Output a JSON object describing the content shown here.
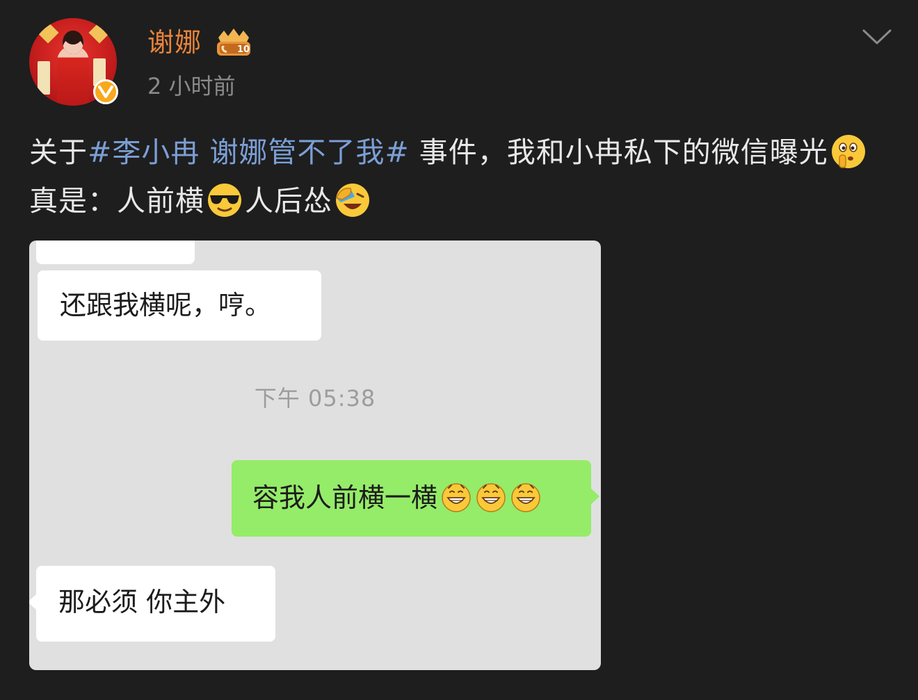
{
  "author": {
    "name": "谢娜",
    "time": "2 小时前",
    "level_badge_text": "10"
  },
  "post": {
    "prefix": "关于",
    "hashtag": "#李小冉 谢娜管不了我#",
    "text_1": " 事件，我和小冉私下的微信曝光",
    "text_2": "  真是：人前横",
    "text_3": "人后怂"
  },
  "chat": {
    "msg_in_1": "还跟我横呢，哼。",
    "time_label": "下午 05:38",
    "msg_out": "容我人前横一横",
    "msg_in_2": "那必须 你主外"
  },
  "colors": {
    "background": "#1e1e1e",
    "username": "#e8833a",
    "hashtag": "#7b9fd6",
    "bubble_out": "#95ec69",
    "chat_bg": "#e0e0e0"
  },
  "icons": {
    "verify": "verified-v-icon",
    "level": "crown-level-badge-icon",
    "more": "chevron-down-icon",
    "emoji_thinking": "shushing-face-icon",
    "emoji_cool": "sunglasses-face-icon",
    "emoji_laugh": "facepalm-laughing-icon",
    "emoji_grin": "grinning-face-icon"
  }
}
